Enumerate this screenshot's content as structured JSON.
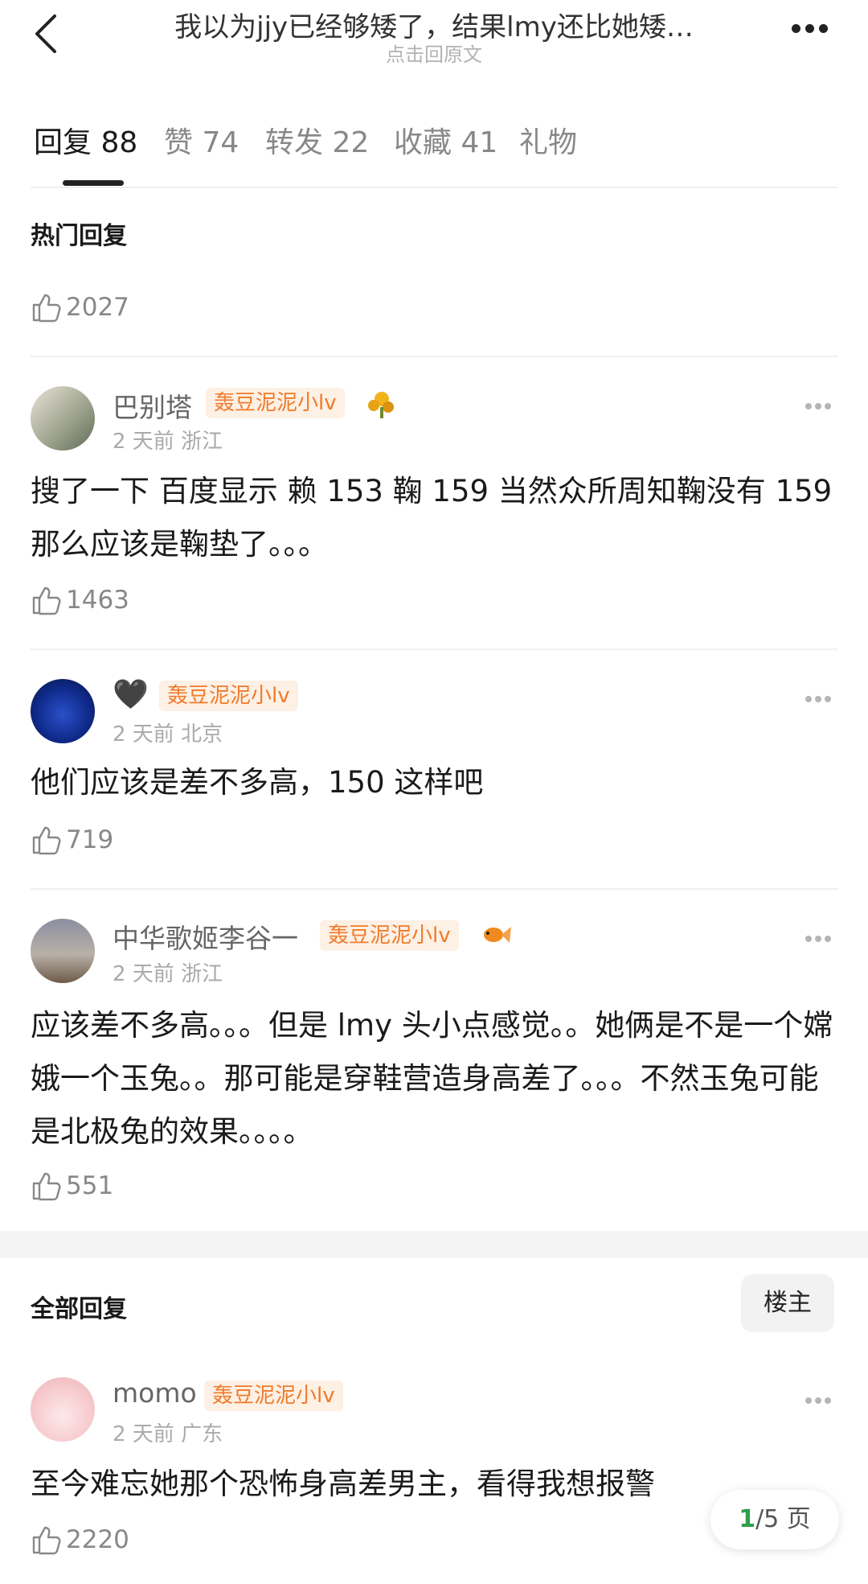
{
  "header": {
    "title": "我以为jjy已经够矮了，结果lmy还比她矮…",
    "subtitle": "点击回原文"
  },
  "tabs": [
    {
      "label": "回复 88"
    },
    {
      "label": "赞 74"
    },
    {
      "label": "转发 22"
    },
    {
      "label": "收藏 41"
    },
    {
      "label": "礼物"
    }
  ],
  "hot": {
    "title": "热门回复",
    "top_likes": "2027",
    "comments": [
      {
        "name": "巴别塔",
        "badge": "轰豆泥泥小lv",
        "meta": "2 天前  浙江",
        "text": "搜了一下 百度显示 赖 153 鞠 159 当然众所周知鞠没有 159 那么应该是鞠垫了。。。",
        "likes": "1463"
      },
      {
        "name": "🖤",
        "badge": "轰豆泥泥小lv",
        "meta": "2 天前  北京",
        "text": "他们应该是差不多高，150 这样吧",
        "likes": "719"
      },
      {
        "name": "中华歌姬李谷一",
        "badge": "轰豆泥泥小lv",
        "meta": "2 天前  浙江",
        "text": "应该差不多高。。。但是 lmy 头小点感觉。。她俩是不是一个嫦娥一个玉兔。。那可能是穿鞋营造身高差了。。。不然玉兔可能是北极兔的效果。。。。",
        "likes": "551"
      }
    ]
  },
  "all": {
    "title": "全部回复",
    "owner_label": "楼主",
    "comments": [
      {
        "name": "momo",
        "badge": "轰豆泥泥小lv",
        "meta": "2 天前  广东",
        "text": "至今难忘她那个恐怖身高差男主，看得我想报警",
        "likes": "2220"
      }
    ]
  },
  "pager": {
    "current": "1",
    "total": "/5 页"
  }
}
